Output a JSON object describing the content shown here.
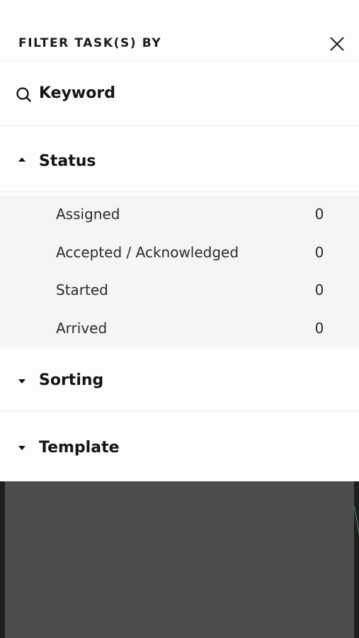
{
  "header": {
    "title": "FILTER TASK(S) BY",
    "close_icon": "close-icon"
  },
  "keyword": {
    "label": "Keyword",
    "icon": "search-icon"
  },
  "status": {
    "label": "Status",
    "expanded": true,
    "items": [
      {
        "label": "Assigned",
        "count": "0"
      },
      {
        "label": "Accepted / Acknowledged",
        "count": "0"
      },
      {
        "label": "Started",
        "count": "0"
      },
      {
        "label": "Arrived",
        "count": "0"
      }
    ]
  },
  "sorting": {
    "label": "Sorting",
    "expanded": false
  },
  "template": {
    "label": "Template",
    "expanded": false
  },
  "colors": {
    "panel_bg": "#fdfdfd",
    "list_bg": "#f5f5f5",
    "overlay_bg": "#4c4c4c",
    "text": "#151515"
  }
}
